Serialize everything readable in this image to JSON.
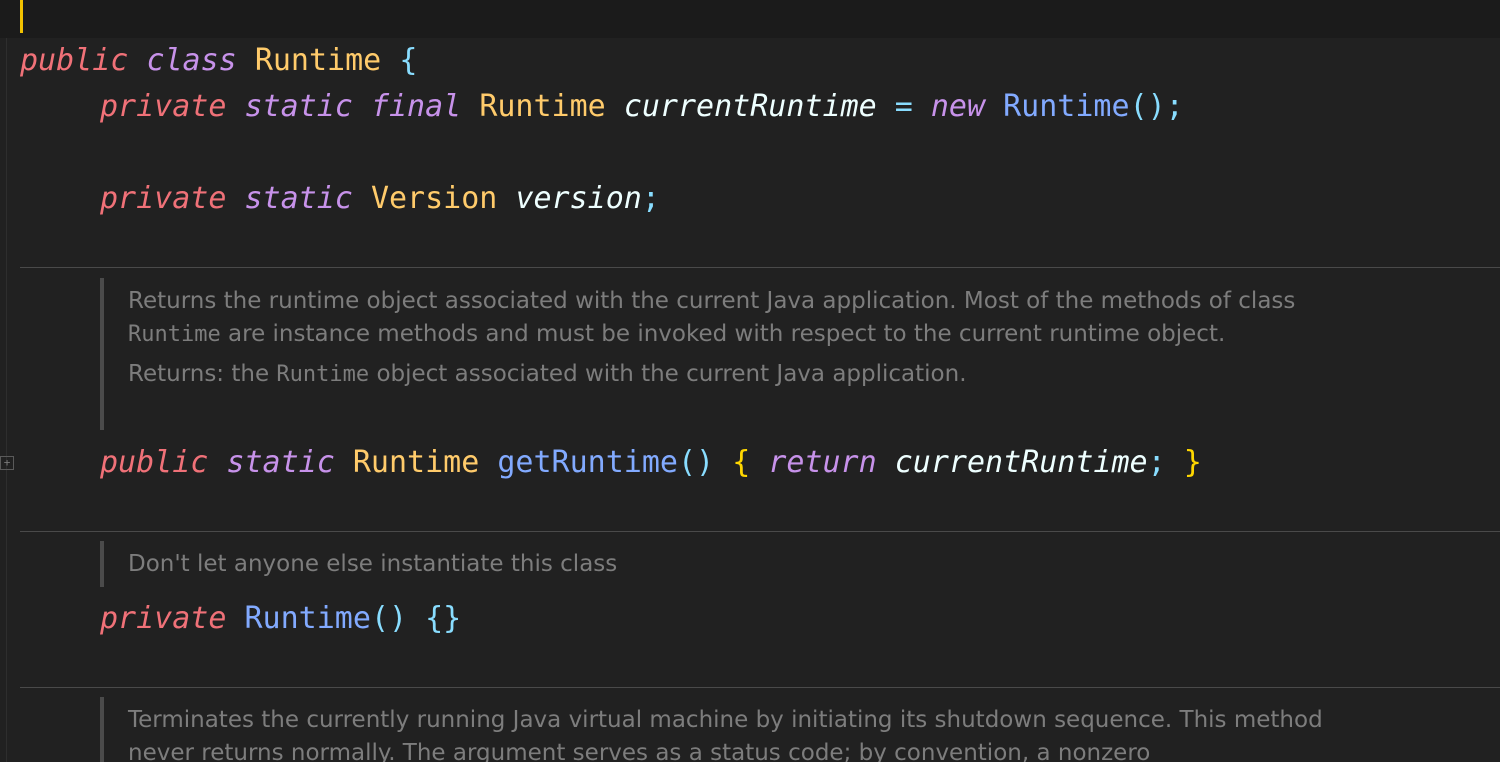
{
  "editor": {
    "line1": {
      "kw_public": "public",
      "kw_class": "class",
      "class_name": "Runtime",
      "open_brace": "{"
    },
    "line2": {
      "kw_private": "private",
      "kw_static": "static",
      "kw_final": "final",
      "type": "Runtime",
      "field": "currentRuntime",
      "eq": "=",
      "kw_new": "new",
      "ctor": "Runtime",
      "tail": "();"
    },
    "line3": {
      "kw_private": "private",
      "kw_static": "static",
      "type": "Version",
      "field": "version",
      "semi": ";"
    },
    "doc1": {
      "p1_a": "Returns the runtime object associated with the current Java application. Most of the methods of class ",
      "p1_code": "Runtime",
      "p1_b": " are instance methods and must be invoked with respect to the current runtime object.",
      "p2_a": "Returns: the ",
      "p2_code": "Runtime",
      "p2_b": " object associated with the current Java application."
    },
    "line4": {
      "kw_public": "public",
      "kw_static": "static",
      "type": "Runtime",
      "method": "getRuntime",
      "parens": "()",
      "open_brace": "{",
      "kw_return": "return",
      "field": "currentRuntime",
      "semi": ";",
      "close_brace": "}"
    },
    "doc2": {
      "text": "Don't let anyone else instantiate this class"
    },
    "line5": {
      "kw_private": "private",
      "ctor": "Runtime",
      "parens": "()",
      "braces": "{}"
    },
    "doc3": {
      "text": "Terminates the currently running Java virtual machine by initiating its shutdown sequence. This method never returns normally. The argument serves as a status code; by convention, a nonzero"
    },
    "fold_icon": "+"
  },
  "colors": {
    "background": "#212121",
    "keyword_red": "#f07178",
    "keyword_purple": "#c792ea",
    "type_yellow": "#ffcb6b",
    "function_blue": "#82aaff",
    "punct_cyan": "#89ddff",
    "brace_gold": "#ffd700",
    "doc_gray": "#7d7d7d",
    "caret": "#f2c200"
  }
}
